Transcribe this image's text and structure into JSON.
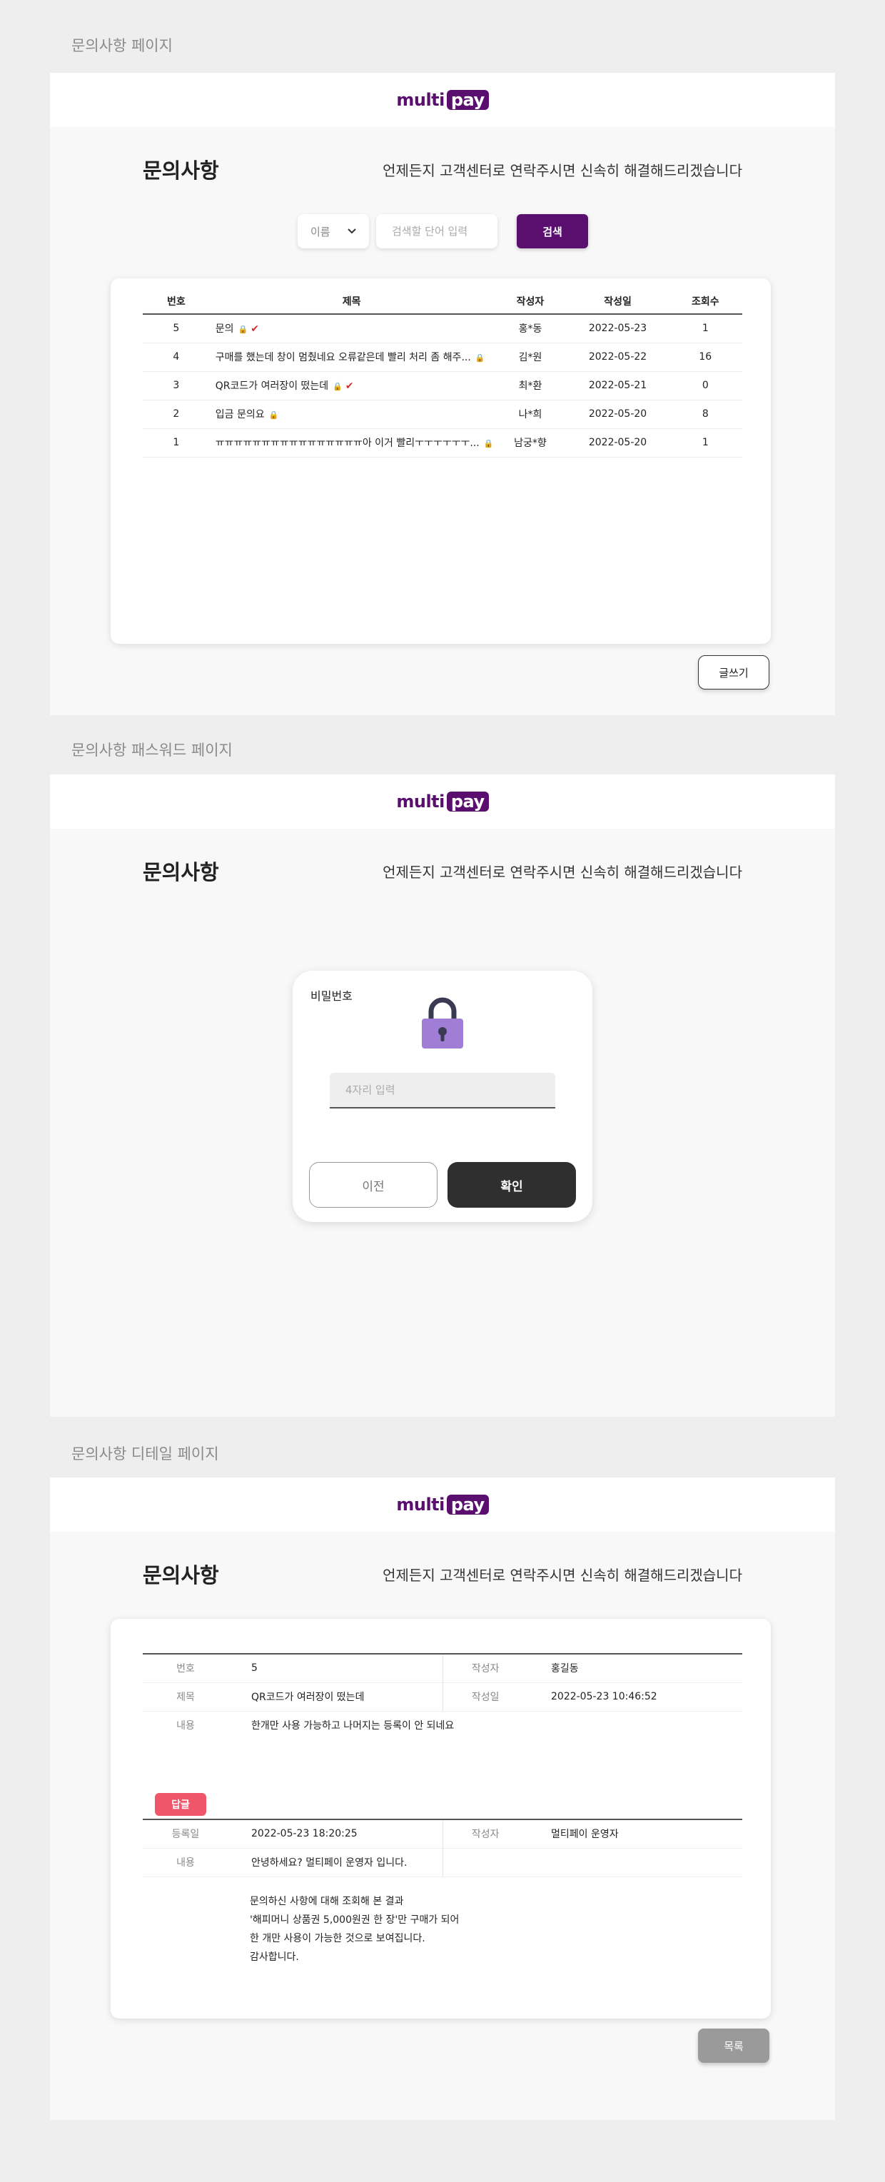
{
  "brand": {
    "multi": "multi",
    "pay": "pay",
    "color": "#5a0f6e"
  },
  "page_title": "문의사항",
  "page_subtitle": "언제든지 고객센터로 연락주시면 신속히 해결해드리겠습니다",
  "list_page": {
    "caption": "문의사항 페이지",
    "search": {
      "select_value": "이름",
      "input_placeholder": "검색할 단어 입력",
      "button_label": "검색"
    },
    "columns": [
      "번호",
      "제목",
      "작성자",
      "작성일",
      "조회수"
    ],
    "rows": [
      {
        "no": "5",
        "title": "문의",
        "locked": true,
        "answered": true,
        "author": "홍*동",
        "date": "2022-05-23",
        "views": "1"
      },
      {
        "no": "4",
        "title": "구매를 했는데 창이 멈췄네요 오류같은데 빨리 처리 좀 해주...",
        "locked": true,
        "answered": false,
        "author": "김*원",
        "date": "2022-05-22",
        "views": "16"
      },
      {
        "no": "3",
        "title": "QR코드가 여러장이 떴는데",
        "locked": true,
        "answered": true,
        "author": "최*환",
        "date": "2022-05-21",
        "views": "0"
      },
      {
        "no": "2",
        "title": "입금 문의요",
        "locked": true,
        "answered": false,
        "author": "나*희",
        "date": "2022-05-20",
        "views": "8"
      },
      {
        "no": "1",
        "title": "ㅠㅠㅠㅠㅠㅠㅠㅠㅠㅠㅠㅠㅠㅠㅠㅠ아 이거 빨리ㅜㅜㅜㅜㅜㅜ...",
        "locked": true,
        "answered": false,
        "author": "남궁*향",
        "date": "2022-05-20",
        "views": "1"
      }
    ],
    "write_button": "글쓰기"
  },
  "password_page": {
    "caption": "문의사항 패스워드 페이지",
    "label": "비밀번호",
    "input_placeholder": "4자리 입력",
    "prev_button": "이전",
    "confirm_button": "확인"
  },
  "detail_page": {
    "caption": "문의사항 디테일 페이지",
    "post": {
      "no_label": "번호",
      "no": "5",
      "author_label": "작성자",
      "author": "홍길동",
      "title_label": "제목",
      "title": "QR코드가 여러장이 떴는데",
      "date_label": "작성일",
      "date": "2022-05-23 10:46:52",
      "content_label": "내용",
      "content": "한개만 사용 가능하고 나머지는 등록이 안 되네요"
    },
    "reply_badge": "답글",
    "reply": {
      "reg_label": "등록일",
      "reg_date": "2022-05-23 18:20:25",
      "author_label": "작성자",
      "author": "멀티페이 운영자",
      "content_label": "내용",
      "greeting": "안녕하세요? 멀티페이 운영자 입니다.",
      "body": [
        "문의하신 사항에 대해 조회해 본 결과",
        "'해피머니 상품권 5,000원권 한 장'만 구매가 되어",
        "한 개만 사용이 가능한 것으로 보여집니다.",
        "감사합니다."
      ]
    },
    "list_button": "목록"
  }
}
